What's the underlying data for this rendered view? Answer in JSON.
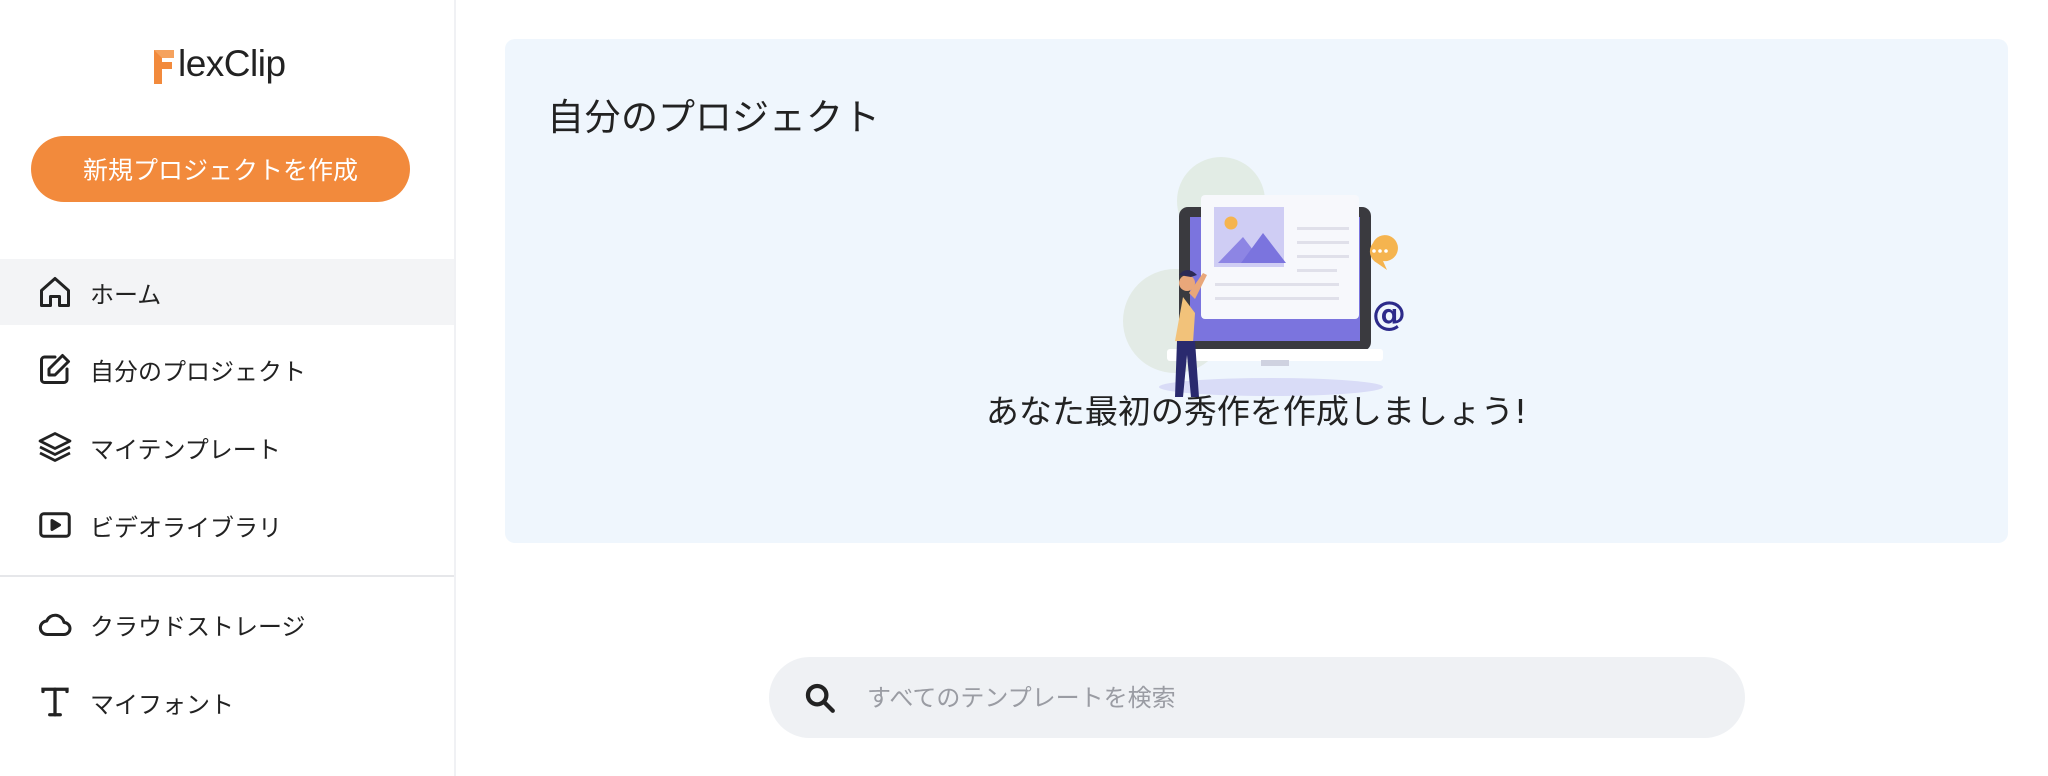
{
  "brand": {
    "logo_mark": "F",
    "logo_rest": "lexClip",
    "accent": "#f28a3c"
  },
  "sidebar": {
    "new_project_label": "新規プロジェクトを作成",
    "items": [
      {
        "label": "ホーム",
        "icon": "home-icon",
        "active": true
      },
      {
        "label": "自分のプロジェクト",
        "icon": "edit-icon"
      },
      {
        "label": "マイテンプレート",
        "icon": "layers-icon"
      },
      {
        "label": "ビデオライブラリ",
        "icon": "video-icon"
      },
      {
        "label": "クラウドストレージ",
        "icon": "cloud-icon"
      },
      {
        "label": "マイフォント",
        "icon": "font-icon"
      }
    ]
  },
  "main": {
    "section_title": "自分のプロジェクト",
    "empty_message": "あなた最初の秀作を作成しましょう!",
    "illustration": "empty-projects-illustration"
  },
  "search": {
    "placeholder": "すべてのテンプレートを検索",
    "value": ""
  }
}
